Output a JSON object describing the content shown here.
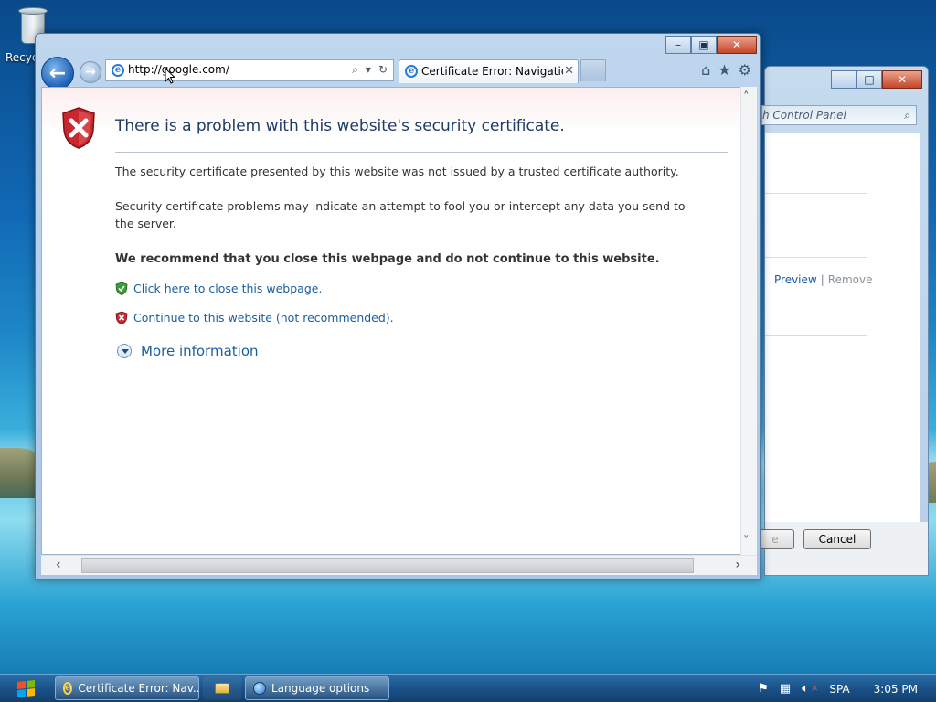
{
  "desktop": {
    "recycle_bin_label": "Recyc"
  },
  "control_panel_window": {
    "search_placeholder": "h Control Panel",
    "links": {
      "preview": "Preview",
      "separator": "|",
      "remove": "Remove"
    },
    "buttons": {
      "partial_button": "e",
      "cancel": "Cancel"
    }
  },
  "ie": {
    "address": "http://google.com/",
    "tab_title": "Certificate Error: Navigation...",
    "error_page": {
      "title": "There is a problem with this website's security certificate.",
      "paragraph_1": "The security certificate presented by this website was not issued by a trusted certificate authority.",
      "paragraph_2": "Security certificate problems may indicate an attempt to fool you or intercept any data you send to the server.",
      "recommendation": "We recommend that you close this webpage and do not continue to this website.",
      "close_link": "Click here to close this webpage.",
      "continue_link": "Continue to this website (not recommended).",
      "more_info": "More information"
    }
  },
  "taskbar": {
    "items": [
      {
        "label": "Certificate Error: Nav...",
        "icon": "ie-icon"
      },
      {
        "label": "",
        "icon": "folder-icon"
      },
      {
        "label": "Language options",
        "icon": "language-icon"
      }
    ],
    "tray": {
      "language": "SPA",
      "time": "3:05 PM"
    }
  },
  "colors": {
    "accent": "#1b5e9e",
    "title_text": "#1f3c66",
    "error_red": "#c8282e",
    "safe_green": "#3f9a3a"
  }
}
